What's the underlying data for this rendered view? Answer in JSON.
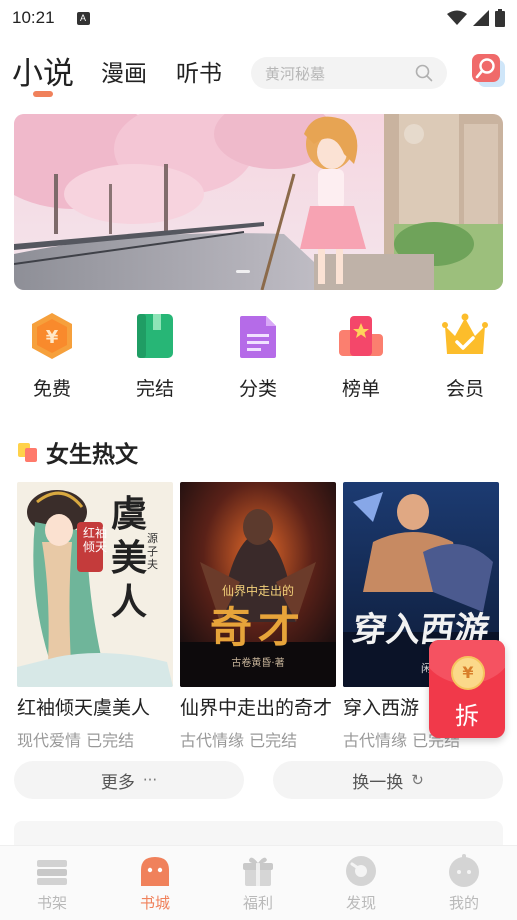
{
  "status_bar": {
    "time": "10:21",
    "notification_badge": "A"
  },
  "top_nav": {
    "tabs": [
      {
        "label": "小说",
        "active": true
      },
      {
        "label": "漫画",
        "active": false
      },
      {
        "label": "听书",
        "active": false
      }
    ],
    "search_placeholder": "黄河秘墓",
    "accent_color": "#f0815b"
  },
  "banner": {
    "description_icon": "anime-girl-cherry-blossom-banner"
  },
  "shortcuts": [
    {
      "label": "免费",
      "icon": "yuan-coin-icon"
    },
    {
      "label": "完结",
      "icon": "book-icon"
    },
    {
      "label": "分类",
      "icon": "document-icon"
    },
    {
      "label": "榜单",
      "icon": "ranking-icon"
    },
    {
      "label": "会员",
      "icon": "crown-icon"
    }
  ],
  "section": {
    "title": "女生热文"
  },
  "books": [
    {
      "title": "红袖倾天虞美人",
      "meta": "现代爱情 已完结",
      "cover_title": "虞美人",
      "cover_sub": "红袖倾天",
      "cover_author": "源子夫"
    },
    {
      "title": "仙界中走出的奇才",
      "meta": "古代情缘 已完结",
      "cover_title": "奇才",
      "cover_sub": "仙界中走出的",
      "cover_author": "古卷黄昏·著"
    },
    {
      "title": "穿入西游",
      "meta": "古代情缘 已完结",
      "cover_title": "穿入西游",
      "cover_sub": "",
      "cover_author": "闲云/著"
    }
  ],
  "red_packet": {
    "coin": "¥",
    "label": "拆"
  },
  "actions": {
    "more": "更多",
    "more_glyph": "···",
    "refresh": "换一换",
    "refresh_glyph": "↻"
  },
  "bottom_nav": [
    {
      "label": "书架",
      "icon": "bookshelf-icon",
      "active": false
    },
    {
      "label": "书城",
      "icon": "bookstore-icon",
      "active": true
    },
    {
      "label": "福利",
      "icon": "gift-icon",
      "active": false
    },
    {
      "label": "发现",
      "icon": "discover-icon",
      "active": false
    },
    {
      "label": "我的",
      "icon": "profile-icon",
      "active": false
    }
  ]
}
